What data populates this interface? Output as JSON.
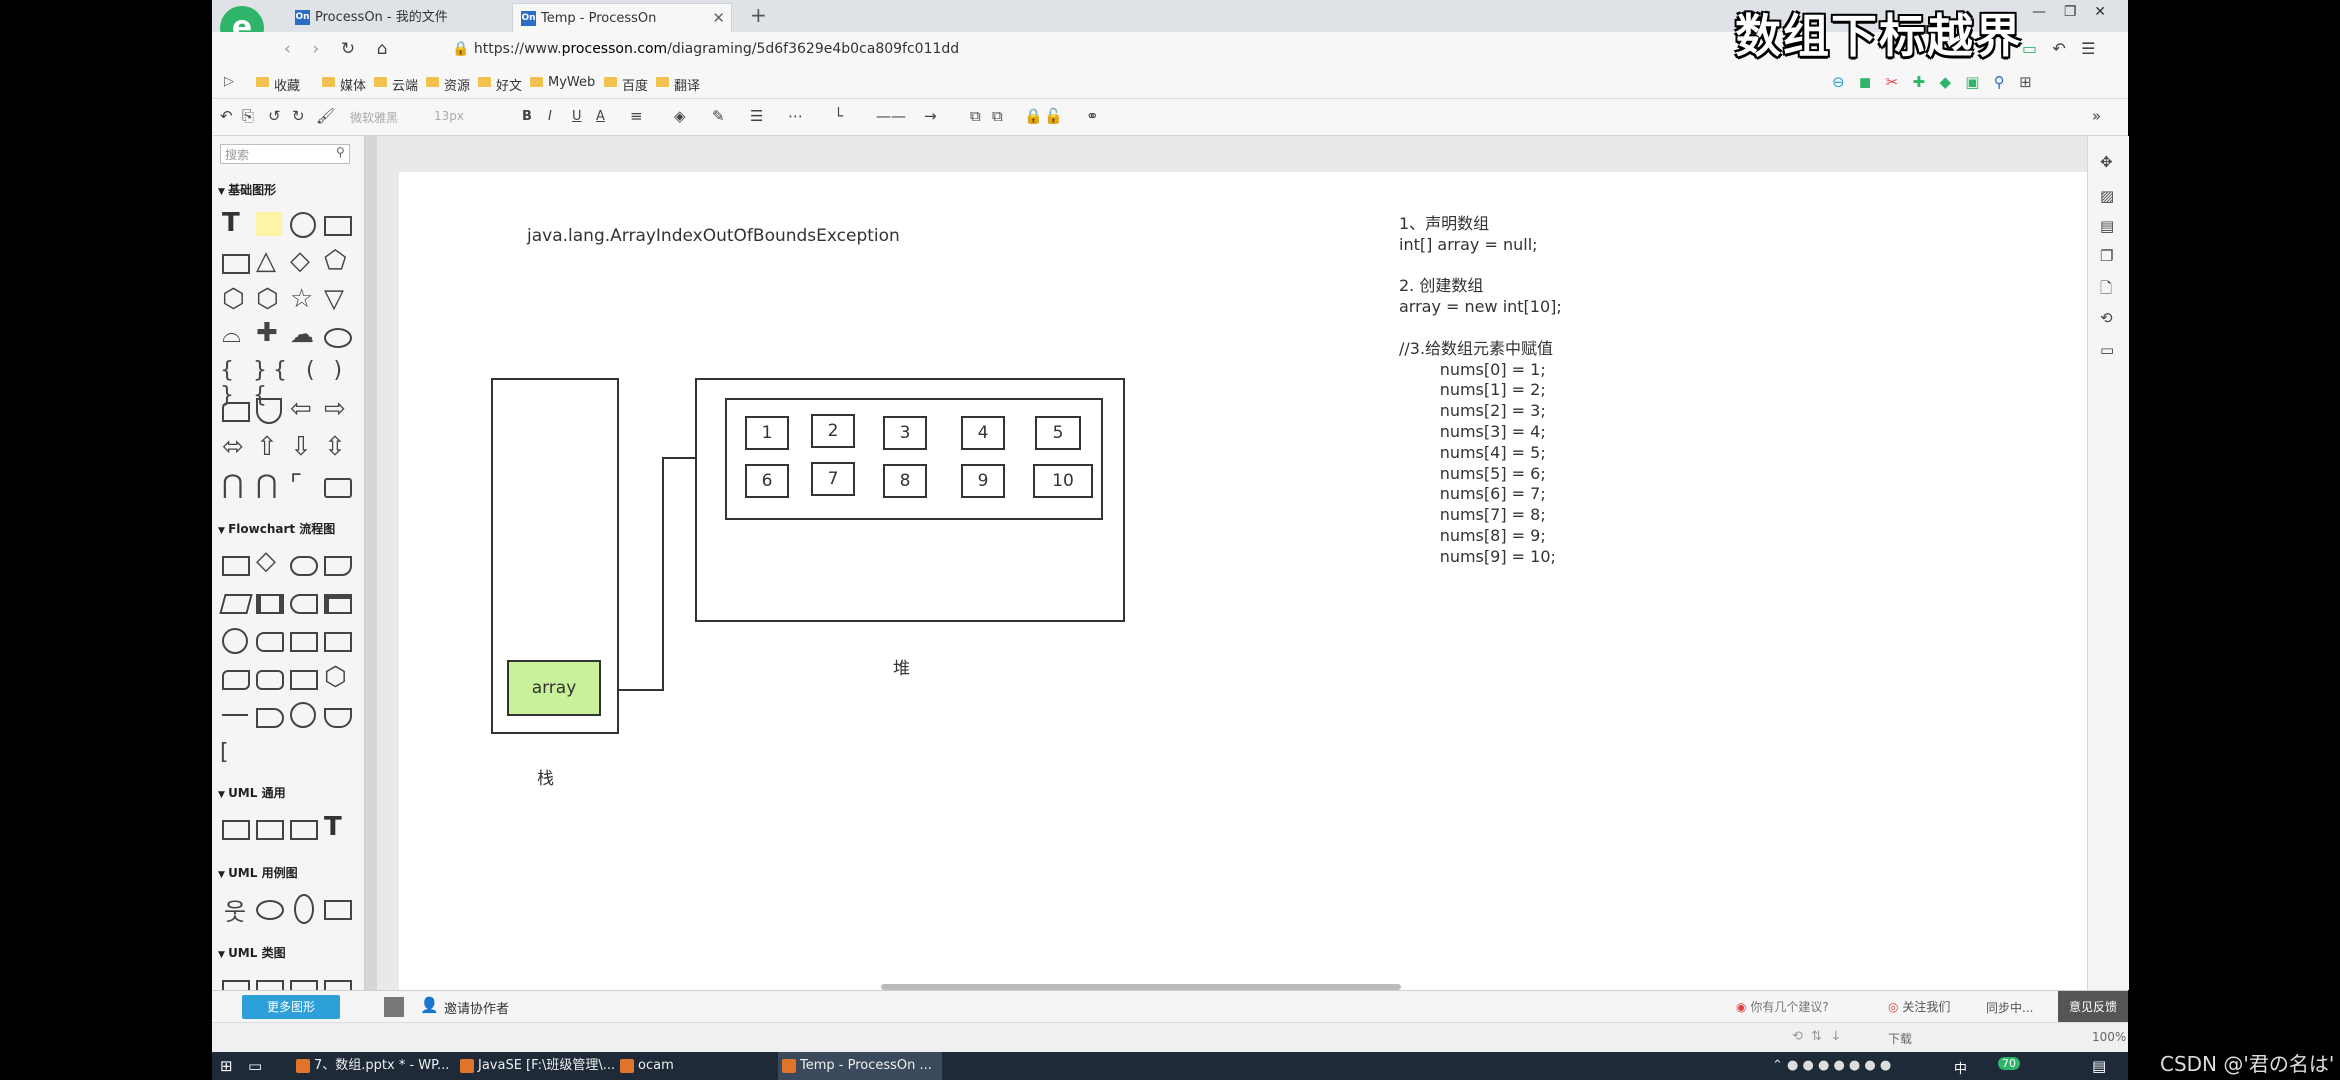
{
  "browser": {
    "tabs": [
      {
        "icon": "On",
        "label": "ProcessOn - 我的文件"
      },
      {
        "icon": "On",
        "label": "Temp - ProcessOn",
        "active": true
      }
    ],
    "url_prefix": "https://www.",
    "url_domain": "processon.com",
    "url_path": "/diagraming/5d6f3629e4b0ca809fc011dd",
    "bookmarks": [
      "收藏",
      "媒体",
      "云端",
      "资源",
      "好文",
      "MyWeb",
      "百度",
      "翻译"
    ]
  },
  "overlay_title": "数组下标越界",
  "toolbar": {
    "font_name": "微软雅黑",
    "font_size": "13px",
    "bold": "B",
    "italic": "I",
    "underline": "U",
    "font_color": "A"
  },
  "left_panel": {
    "search_placeholder": "搜索",
    "categories": {
      "basic": "基础图形",
      "flowchart": "Flowchart 流程图",
      "uml_general": "UML 通用",
      "uml_usecase": "UML 用例图",
      "uml_class": "UML 类图"
    },
    "more_shapes": "更多图形"
  },
  "diagram": {
    "exception": "java.lang.ArrayIndexOutOfBoundsException",
    "array_label": "array",
    "stack_label": "栈",
    "heap_label": "堆",
    "cells_row1": [
      "1",
      "2",
      "3",
      "4",
      "5"
    ],
    "cells_row2": [
      "6",
      "7",
      "8",
      "9",
      "10"
    ],
    "code": [
      "1、声明数组",
      "int[] array = null;",
      "",
      "2. 创建数组",
      "array = new int[10];",
      "",
      "//3.给数组元素中赋值",
      "        nums[0] = 1;",
      "        nums[1] = 2;",
      "        nums[2] = 3;",
      "        nums[3] = 4;",
      "        nums[4] = 5;",
      "        nums[5] = 6;",
      "        nums[6] = 7;",
      "        nums[7] = 8;",
      "        nums[8] = 9;",
      "        nums[9] = 10;"
    ]
  },
  "bottom_bar": {
    "invite": "邀请协作者",
    "notice1": "你有几个建议?",
    "notice2": "关注我们",
    "sync": "同步中...",
    "feedback": "意见反馈"
  },
  "status": {
    "download": "下载",
    "zoom": "100%"
  },
  "taskbar": {
    "items": [
      "7、数组.pptx * - WP...",
      "JavaSE [F:\\班级管理\\...",
      "ocam",
      "Temp - ProcessOn ..."
    ],
    "lang": "中",
    "badge": "70"
  },
  "watermark": "CSDN @'君の名は'",
  "colors": {
    "array_fill": "#c9f09a",
    "more_shapes_button": "#2d9fd9",
    "logo": "#2fb56a"
  }
}
